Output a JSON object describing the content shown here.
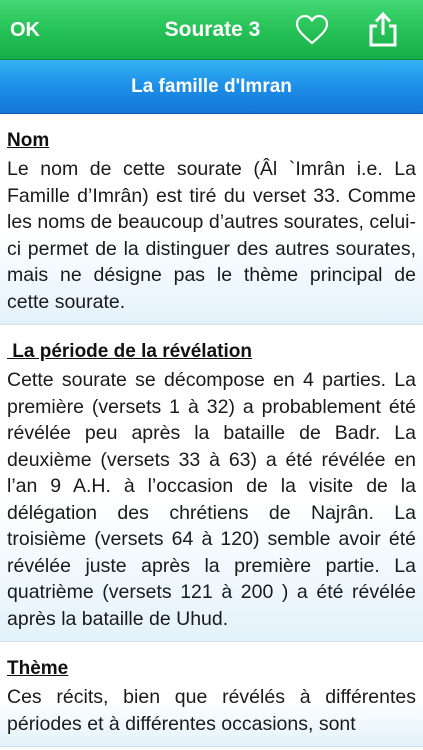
{
  "header": {
    "ok_label": "OK",
    "title": "Sourate 3",
    "favorite_icon": "heart-outline-icon",
    "share_icon": "share-icon",
    "accent": "#26c257"
  },
  "subheader": {
    "title": "La famille d'Imran",
    "accent": "#1d8ee8"
  },
  "sections": [
    {
      "heading": "Nom",
      "text": "Le nom de cette sourate (Âl `Imrân i.e. La Famille d’Imrân) est tiré du verset 33. Comme les noms de beaucoup d’autres sourates, celui-ci permet de la distinguer des autres sourates, mais ne désigne pas le thème principal de cette sourate."
    },
    {
      "heading": " La période de la révélation",
      "text": "Cette sourate se décompose en 4 parties. La première (versets 1 à 32) a probablement été révélée peu après la bataille de Badr. La deuxième (versets 33 à 63) a été révélée en l’an 9 A.H. à l’occasion de la visite de la délégation des chrétiens de Najrân. La troisième (versets 64 à 120) semble avoir été révélée juste après la première partie. La quatrième (versets 121 à 200 ) a été révélée après la bataille de Uhud."
    },
    {
      "heading": "Thème",
      "text": "Ces récits, bien que révélés à différentes périodes et à différentes occasions, sont"
    }
  ]
}
